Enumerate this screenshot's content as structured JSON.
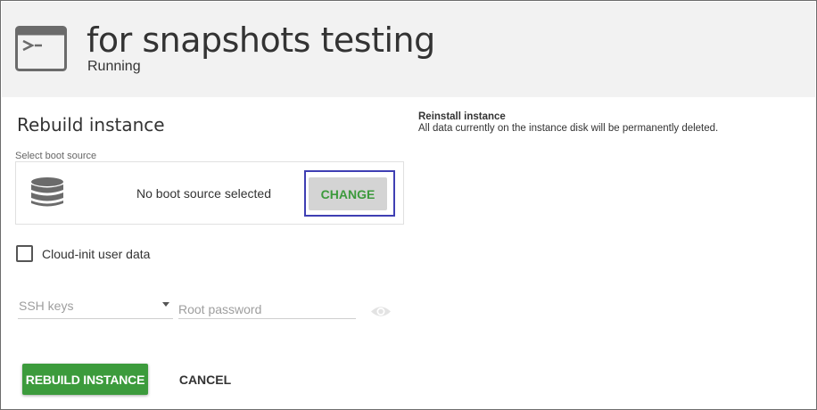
{
  "header": {
    "title": "for snapshots testing",
    "status": "Running",
    "icon": "terminal-icon"
  },
  "form": {
    "section_title": "Rebuild instance",
    "boot_source_label": "Select boot source",
    "boot_source_value": "No boot source selected",
    "boot_source_icon": "database-icon",
    "change_label": "CHANGE",
    "cloud_init_label": "Cloud-init user data",
    "cloud_init_checked": false,
    "ssh_keys_placeholder": "SSH keys",
    "root_password_placeholder": "Root password",
    "password_toggle_icon": "eye-icon"
  },
  "info": {
    "heading": "Reinstall instance",
    "text": "All data currently on the instance disk will be permanently deleted."
  },
  "actions": {
    "rebuild_label": "REBUILD INSTANCE",
    "cancel_label": "CANCEL"
  },
  "colors": {
    "primary_green": "#3c9b3c",
    "focus_outline": "#3f3fb3",
    "header_bg": "#f2f2f2"
  }
}
